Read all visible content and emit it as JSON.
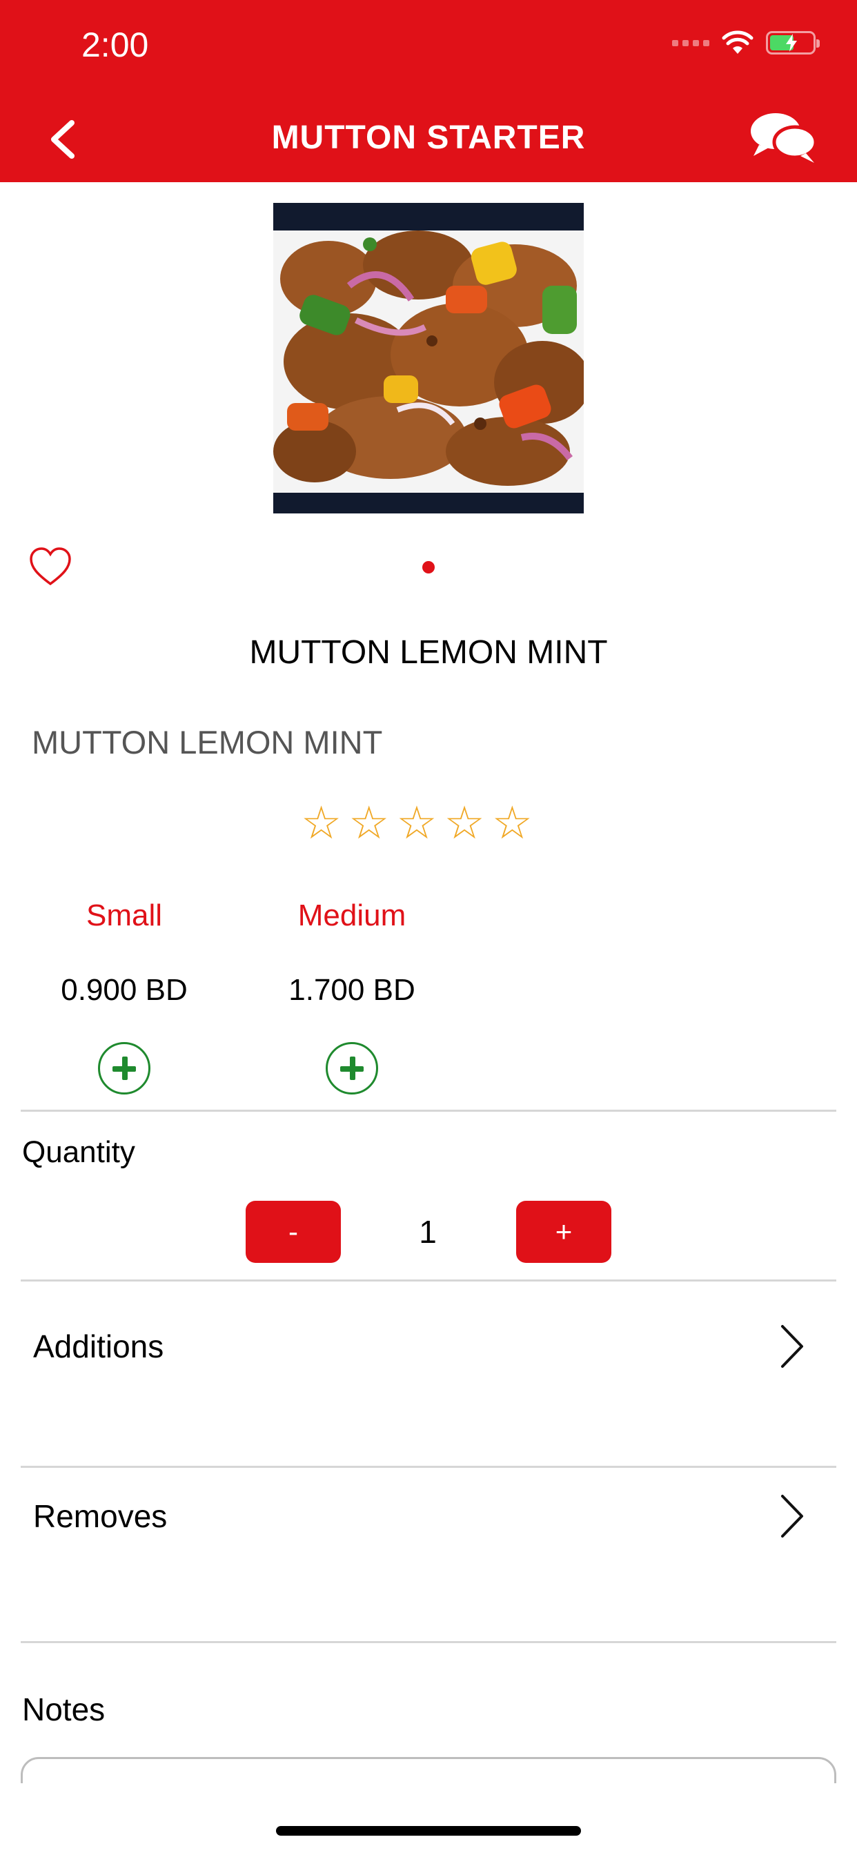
{
  "status_bar": {
    "time": "2:00",
    "icons": [
      "cellular-icon",
      "wifi-icon",
      "battery-charging-icon"
    ]
  },
  "header": {
    "title": "MUTTON STARTER",
    "back_icon": "chevron-left-icon",
    "chat_icon": "chat-bubbles-icon"
  },
  "product": {
    "title": "MUTTON LEMON MINT",
    "description": "MUTTON LEMON MINT",
    "rating": 0,
    "rating_max": 5
  },
  "sizes": [
    {
      "label": "Small",
      "price": "0.900 BD"
    },
    {
      "label": "Medium",
      "price": "1.700 BD"
    }
  ],
  "quantity": {
    "label": "Quantity",
    "minus_label": "-",
    "value": "1",
    "plus_label": "+"
  },
  "options": {
    "additions_label": "Additions",
    "removes_label": "Removes"
  },
  "notes": {
    "label": "Notes",
    "placeholder": ""
  },
  "colors": {
    "brand_red": "#e01118",
    "add_green": "#1f8a2e",
    "star": "#f0a826"
  }
}
